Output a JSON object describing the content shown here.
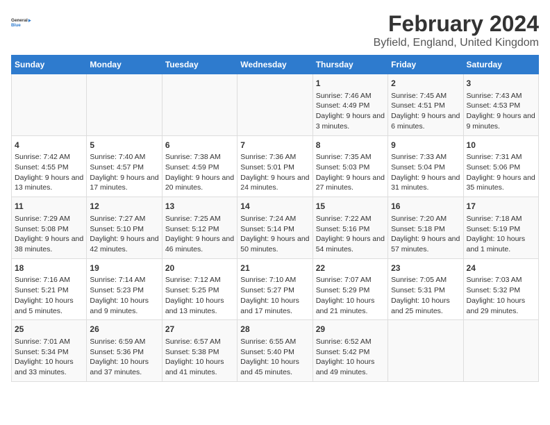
{
  "logo": {
    "line1": "General",
    "line2": "Blue"
  },
  "title": "February 2024",
  "subtitle": "Byfield, England, United Kingdom",
  "days": [
    "Sunday",
    "Monday",
    "Tuesday",
    "Wednesday",
    "Thursday",
    "Friday",
    "Saturday"
  ],
  "weeks": [
    [
      {
        "day": "",
        "content": ""
      },
      {
        "day": "",
        "content": ""
      },
      {
        "day": "",
        "content": ""
      },
      {
        "day": "",
        "content": ""
      },
      {
        "day": "1",
        "content": "Sunrise: 7:46 AM\nSunset: 4:49 PM\nDaylight: 9 hours and 3 minutes."
      },
      {
        "day": "2",
        "content": "Sunrise: 7:45 AM\nSunset: 4:51 PM\nDaylight: 9 hours and 6 minutes."
      },
      {
        "day": "3",
        "content": "Sunrise: 7:43 AM\nSunset: 4:53 PM\nDaylight: 9 hours and 9 minutes."
      }
    ],
    [
      {
        "day": "4",
        "content": "Sunrise: 7:42 AM\nSunset: 4:55 PM\nDaylight: 9 hours and 13 minutes."
      },
      {
        "day": "5",
        "content": "Sunrise: 7:40 AM\nSunset: 4:57 PM\nDaylight: 9 hours and 17 minutes."
      },
      {
        "day": "6",
        "content": "Sunrise: 7:38 AM\nSunset: 4:59 PM\nDaylight: 9 hours and 20 minutes."
      },
      {
        "day": "7",
        "content": "Sunrise: 7:36 AM\nSunset: 5:01 PM\nDaylight: 9 hours and 24 minutes."
      },
      {
        "day": "8",
        "content": "Sunrise: 7:35 AM\nSunset: 5:03 PM\nDaylight: 9 hours and 27 minutes."
      },
      {
        "day": "9",
        "content": "Sunrise: 7:33 AM\nSunset: 5:04 PM\nDaylight: 9 hours and 31 minutes."
      },
      {
        "day": "10",
        "content": "Sunrise: 7:31 AM\nSunset: 5:06 PM\nDaylight: 9 hours and 35 minutes."
      }
    ],
    [
      {
        "day": "11",
        "content": "Sunrise: 7:29 AM\nSunset: 5:08 PM\nDaylight: 9 hours and 38 minutes."
      },
      {
        "day": "12",
        "content": "Sunrise: 7:27 AM\nSunset: 5:10 PM\nDaylight: 9 hours and 42 minutes."
      },
      {
        "day": "13",
        "content": "Sunrise: 7:25 AM\nSunset: 5:12 PM\nDaylight: 9 hours and 46 minutes."
      },
      {
        "day": "14",
        "content": "Sunrise: 7:24 AM\nSunset: 5:14 PM\nDaylight: 9 hours and 50 minutes."
      },
      {
        "day": "15",
        "content": "Sunrise: 7:22 AM\nSunset: 5:16 PM\nDaylight: 9 hours and 54 minutes."
      },
      {
        "day": "16",
        "content": "Sunrise: 7:20 AM\nSunset: 5:18 PM\nDaylight: 9 hours and 57 minutes."
      },
      {
        "day": "17",
        "content": "Sunrise: 7:18 AM\nSunset: 5:19 PM\nDaylight: 10 hours and 1 minute."
      }
    ],
    [
      {
        "day": "18",
        "content": "Sunrise: 7:16 AM\nSunset: 5:21 PM\nDaylight: 10 hours and 5 minutes."
      },
      {
        "day": "19",
        "content": "Sunrise: 7:14 AM\nSunset: 5:23 PM\nDaylight: 10 hours and 9 minutes."
      },
      {
        "day": "20",
        "content": "Sunrise: 7:12 AM\nSunset: 5:25 PM\nDaylight: 10 hours and 13 minutes."
      },
      {
        "day": "21",
        "content": "Sunrise: 7:10 AM\nSunset: 5:27 PM\nDaylight: 10 hours and 17 minutes."
      },
      {
        "day": "22",
        "content": "Sunrise: 7:07 AM\nSunset: 5:29 PM\nDaylight: 10 hours and 21 minutes."
      },
      {
        "day": "23",
        "content": "Sunrise: 7:05 AM\nSunset: 5:31 PM\nDaylight: 10 hours and 25 minutes."
      },
      {
        "day": "24",
        "content": "Sunrise: 7:03 AM\nSunset: 5:32 PM\nDaylight: 10 hours and 29 minutes."
      }
    ],
    [
      {
        "day": "25",
        "content": "Sunrise: 7:01 AM\nSunset: 5:34 PM\nDaylight: 10 hours and 33 minutes."
      },
      {
        "day": "26",
        "content": "Sunrise: 6:59 AM\nSunset: 5:36 PM\nDaylight: 10 hours and 37 minutes."
      },
      {
        "day": "27",
        "content": "Sunrise: 6:57 AM\nSunset: 5:38 PM\nDaylight: 10 hours and 41 minutes."
      },
      {
        "day": "28",
        "content": "Sunrise: 6:55 AM\nSunset: 5:40 PM\nDaylight: 10 hours and 45 minutes."
      },
      {
        "day": "29",
        "content": "Sunrise: 6:52 AM\nSunset: 5:42 PM\nDaylight: 10 hours and 49 minutes."
      },
      {
        "day": "",
        "content": ""
      },
      {
        "day": "",
        "content": ""
      }
    ]
  ]
}
